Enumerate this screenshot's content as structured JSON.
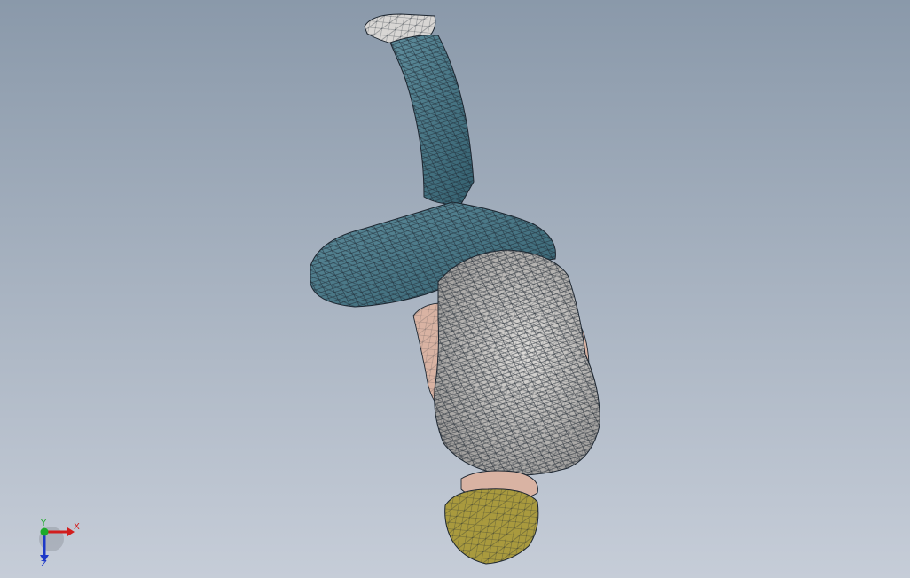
{
  "viewport": {
    "background_top": "#8a99aa",
    "background_bottom": "#c6cdd8"
  },
  "model": {
    "mesh_line_color": "#1d2630",
    "jeans_color": "#4e7d8c",
    "shirt_color": "#c9c7c4",
    "skin_color": "#d9b3a3",
    "hair_color": "#a99a3e",
    "shoe_color": "#d8d6d4"
  },
  "triad": {
    "x_label": "X",
    "y_label": "Y",
    "z_label": "Z",
    "x_color": "#d21d1d",
    "y_color": "#1daa2a",
    "z_color": "#1d39c8"
  }
}
